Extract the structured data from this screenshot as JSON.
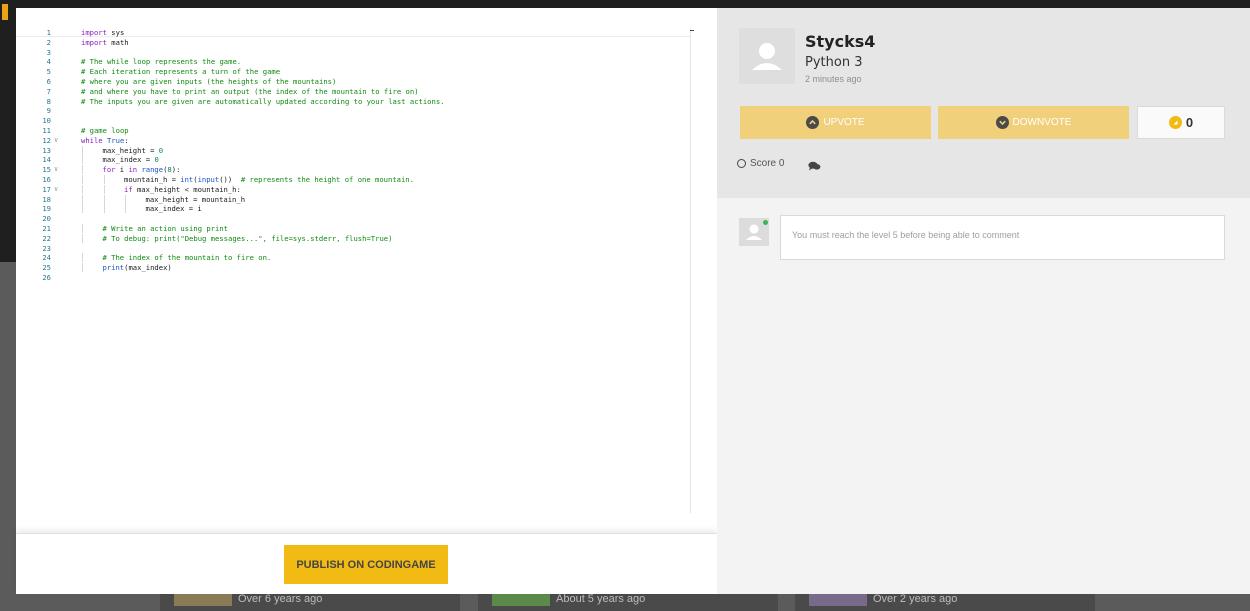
{
  "editor": {
    "lines": [
      {
        "n": "1",
        "indent": 0,
        "tokens": [
          [
            "kw",
            "import"
          ],
          [
            "",
            "sys"
          ]
        ]
      },
      {
        "n": "2",
        "indent": 0,
        "tokens": [
          [
            "kw",
            "import"
          ],
          [
            "",
            "math"
          ]
        ]
      },
      {
        "n": "3",
        "indent": 0,
        "tokens": []
      },
      {
        "n": "4",
        "indent": 0,
        "tokens": [
          [
            "cm",
            "# The while loop represents the game."
          ]
        ]
      },
      {
        "n": "5",
        "indent": 0,
        "tokens": [
          [
            "cm",
            "# Each iteration represents a turn of the game"
          ]
        ]
      },
      {
        "n": "6",
        "indent": 0,
        "tokens": [
          [
            "cm",
            "# where you are given inputs (the heights of the mountains)"
          ]
        ]
      },
      {
        "n": "7",
        "indent": 0,
        "tokens": [
          [
            "cm",
            "# and where you have to print an output (the index of the mountain to fire on)"
          ]
        ]
      },
      {
        "n": "8",
        "indent": 0,
        "tokens": [
          [
            "cm",
            "# The inputs you are given are automatically updated according to your last actions."
          ]
        ]
      },
      {
        "n": "9",
        "indent": 0,
        "tokens": []
      },
      {
        "n": "10",
        "indent": 0,
        "tokens": []
      },
      {
        "n": "11",
        "indent": 0,
        "tokens": [
          [
            "cm",
            "# game loop"
          ]
        ]
      },
      {
        "n": "12",
        "indent": 0,
        "fold": true,
        "tokens": [
          [
            "kw",
            "while"
          ],
          [
            "",
            ""
          ],
          [
            "bi",
            "True"
          ],
          [
            "",
            ":"
          ]
        ]
      },
      {
        "n": "13",
        "indent": 1,
        "tokens": [
          [
            "",
            "max_height = "
          ],
          [
            "num",
            "0"
          ]
        ]
      },
      {
        "n": "14",
        "indent": 1,
        "tokens": [
          [
            "",
            "max_index = "
          ],
          [
            "num",
            "0"
          ]
        ]
      },
      {
        "n": "15",
        "indent": 1,
        "fold": true,
        "tokens": [
          [
            "kw",
            "for"
          ],
          [
            "",
            " i "
          ],
          [
            "kw",
            "in"
          ],
          [
            "",
            ""
          ],
          [
            "bi",
            "range"
          ],
          [
            "",
            "("
          ],
          [
            "num",
            "8"
          ],
          [
            "",
            "):"
          ]
        ]
      },
      {
        "n": "16",
        "indent": 2,
        "tokens": [
          [
            "",
            "mountain_h = "
          ],
          [
            "bi",
            "int"
          ],
          [
            "",
            "("
          ],
          [
            "bi",
            "input"
          ],
          [
            "",
            "())  "
          ],
          [
            "cm",
            "# represents the height of one mountain."
          ]
        ]
      },
      {
        "n": "17",
        "indent": 2,
        "fold": true,
        "tokens": [
          [
            "kw",
            "if"
          ],
          [
            "",
            " max_height < mountain_h:"
          ]
        ]
      },
      {
        "n": "18",
        "indent": 3,
        "tokens": [
          [
            "",
            "max_height = mountain_h"
          ]
        ]
      },
      {
        "n": "19",
        "indent": 3,
        "tokens": [
          [
            "",
            "max_index = i"
          ]
        ]
      },
      {
        "n": "20",
        "indent": 0,
        "tokens": []
      },
      {
        "n": "21",
        "indent": 1,
        "tokens": [
          [
            "cm",
            "# Write an action using print"
          ]
        ]
      },
      {
        "n": "22",
        "indent": 1,
        "tokens": [
          [
            "cm",
            "# To debug: print(\"Debug messages...\", file=sys.stderr, flush=True)"
          ]
        ]
      },
      {
        "n": "23",
        "indent": 0,
        "tokens": []
      },
      {
        "n": "24",
        "indent": 1,
        "tokens": [
          [
            "cm",
            "# The index of the mountain to fire on."
          ]
        ]
      },
      {
        "n": "25",
        "indent": 1,
        "tokens": [
          [
            "bi",
            "print"
          ],
          [
            "",
            "(max_index)"
          ]
        ]
      },
      {
        "n": "26",
        "indent": 0,
        "tokens": []
      }
    ]
  },
  "publish": {
    "label": "PUBLISH ON CODINGAME"
  },
  "author": {
    "username": "Stycks4",
    "language": "Python 3",
    "time": "2 minutes ago"
  },
  "votes": {
    "upvote_label": "UPVOTE",
    "downvote_label": "DOWNVOTE",
    "count": "0"
  },
  "stats": {
    "score": "Score 0"
  },
  "comment": {
    "placeholder": "You must reach the level 5 before being able to comment"
  },
  "background_cards": [
    {
      "time": "Over 6 years ago"
    },
    {
      "time": "About 5 years ago"
    },
    {
      "time": "Over 2 years ago"
    }
  ],
  "colors": {
    "accent": "#f2bb13",
    "vote_button": "#f0d07a",
    "online": "#3fb34f",
    "keyword": "#8a1cc0",
    "builtin": "#1a55c7",
    "number": "#098658",
    "comment": "#108a10"
  }
}
